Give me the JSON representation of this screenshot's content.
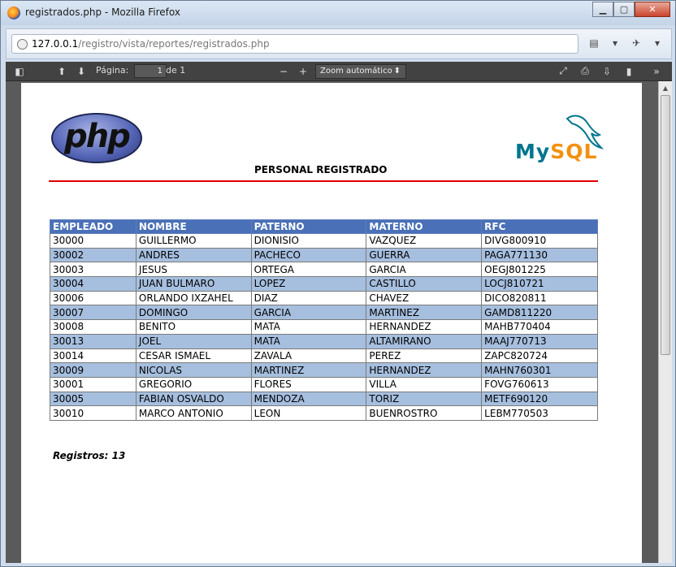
{
  "window": {
    "title": "registrados.php - Mozilla Firefox"
  },
  "address_bar": {
    "host": "127.0.0.1",
    "path": "/registro/vista/reportes/registrados.php"
  },
  "pdf_toolbar": {
    "page_label": "Página:",
    "page_value": "1",
    "page_of": "de 1",
    "zoom": "Zoom automático",
    "zoom_out": "−",
    "zoom_in": "+"
  },
  "report": {
    "php_logo_text": "php",
    "mysql_logo_text": "MySQL",
    "title": "PERSONAL REGISTRADO",
    "columns": [
      "EMPLEADO",
      "NOMBRE",
      "PATERNO",
      "MATERNO",
      "RFC"
    ],
    "rows": [
      [
        "30000",
        "GUILLERMO",
        "DIONISIO",
        "VAZQUEZ",
        "DIVG800910"
      ],
      [
        "30002",
        "ANDRES",
        "PACHECO",
        "GUERRA",
        "PAGA771130"
      ],
      [
        "30003",
        "JESUS",
        "ORTEGA",
        "GARCIA",
        "OEGJ801225"
      ],
      [
        "30004",
        "JUAN BULMARO",
        "LOPEZ",
        "CASTILLO",
        "LOCJ810721"
      ],
      [
        "30006",
        "ORLANDO IXZAHEL",
        "DIAZ",
        "CHAVEZ",
        "DICO820811"
      ],
      [
        "30007",
        "DOMINGO",
        "GARCIA",
        "MARTINEZ",
        "GAMD811220"
      ],
      [
        "30008",
        "BENITO",
        "MATA",
        "HERNANDEZ",
        "MAHB770404"
      ],
      [
        "30013",
        "JOEL",
        "MATA",
        "ALTAMIRANO",
        "MAAJ770713"
      ],
      [
        "30014",
        "CESAR ISMAEL",
        "ZAVALA",
        "PEREZ",
        "ZAPC820724"
      ],
      [
        "30009",
        "NICOLAS",
        "MARTINEZ",
        "HERNANDEZ",
        "MAHN760301"
      ],
      [
        "30001",
        "GREGORIO",
        "FLORES",
        "VILLA",
        "FOVG760613"
      ],
      [
        "30005",
        "FABIAN OSVALDO",
        "MENDOZA",
        "TORIZ",
        "METF690120"
      ],
      [
        "30010",
        "MARCO ANTONIO",
        "LEON",
        "BUENROSTRO",
        "LEBM770503"
      ]
    ],
    "records_label": "Registros: 13"
  },
  "colors": {
    "header_bg": "#4a70b7",
    "alt_row_bg": "#a6bfdf",
    "rule_red": "#e00000"
  }
}
